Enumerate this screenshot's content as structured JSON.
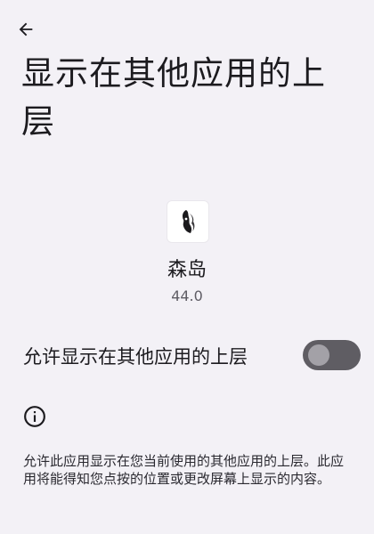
{
  "header": {
    "back_icon": "arrow-back-icon",
    "title": "显示在其他应用的上层"
  },
  "app": {
    "name": "森岛",
    "version": "44.0"
  },
  "permission": {
    "label": "允许显示在其他应用的上层",
    "enabled": false,
    "track_color": "#5f5d63",
    "thumb_color": "#a3a1a7"
  },
  "info": {
    "icon": "info-icon",
    "description": "允许此应用显示在您当前使用的其他应用的上层。此应用将能得知您点按的位置或更改屏幕上显示的内容。"
  },
  "colors": {
    "background": "#f3f1f6",
    "text_primary": "#1c1b1f",
    "text_secondary": "#5e5c64"
  }
}
